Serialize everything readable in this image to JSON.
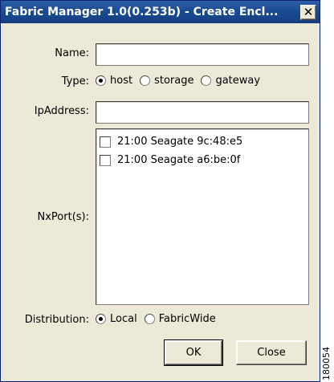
{
  "window": {
    "title": "Fabric Manager 1.0(0.253b) - Create Encl...",
    "close_glyph": "✕"
  },
  "form": {
    "name": {
      "label": "Name:",
      "value": ""
    },
    "type": {
      "label": "Type:",
      "options": [
        "host",
        "storage",
        "gateway"
      ],
      "selected": "host"
    },
    "ip_address": {
      "label": "IpAddress:",
      "value": ""
    },
    "nx_ports": {
      "label": "NxPort(s):",
      "items": [
        {
          "label": "21:00 Seagate 9c:48:e5",
          "checked": false
        },
        {
          "label": "21:00 Seagate a6:be:0f",
          "checked": false
        }
      ]
    },
    "distribution": {
      "label": "Distribution:",
      "options": [
        "Local",
        "FabricWide"
      ],
      "selected": "Local"
    }
  },
  "buttons": {
    "ok_label": "OK",
    "close_label": "Close"
  },
  "figure_id": "180054"
}
